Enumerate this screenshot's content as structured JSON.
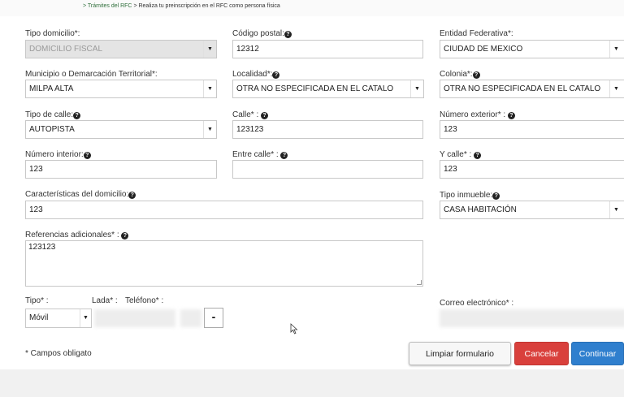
{
  "breadcrumb": {
    "link": "> Trámites del RFC",
    "current": "> Realiza tu preinscripción en el RFC como persona física"
  },
  "help_glyph": "?",
  "fields": {
    "tipo_domicilio": {
      "label": "Tipo domicilio*:",
      "value": "DOMICILIO FISCAL"
    },
    "codigo_postal": {
      "label": "Código postal:",
      "value": "12312"
    },
    "entidad": {
      "label": "Entidad Federativa*:",
      "value": "CIUDAD DE MEXICO"
    },
    "municipio": {
      "label": "Municipio o Demarcación Territorial*:",
      "value": "MILPA ALTA"
    },
    "localidad": {
      "label": "Localidad*:",
      "value": "OTRA NO ESPECIFICADA EN EL CATALO"
    },
    "colonia": {
      "label": "Colonia*:",
      "value": "OTRA NO ESPECIFICADA EN EL CATALO"
    },
    "tipo_calle": {
      "label": "Tipo de calle:",
      "value": "AUTOPISTA"
    },
    "calle": {
      "label": "Calle* :",
      "value": "123123"
    },
    "num_exterior": {
      "label": "Número exterior* :",
      "value": "123"
    },
    "num_interior": {
      "label": "Número interior:",
      "value": "123"
    },
    "entre_calle": {
      "label": "Entre calle* :",
      "value": ""
    },
    "y_calle": {
      "label": "Y calle* :",
      "value": "123"
    },
    "caracteristicas": {
      "label": "Características del domicilio:",
      "value": "123"
    },
    "tipo_inmueble": {
      "label": "Tipo inmueble:",
      "value": "CASA HABITACIÓN"
    },
    "referencias": {
      "label": "Referencias adicionales* :",
      "value": "123123"
    },
    "tipo": {
      "label": "Tipo* :",
      "value": "Móvil"
    },
    "lada": {
      "label": "Lada* :"
    },
    "telefono": {
      "label": "Teléfono* :"
    },
    "correo": {
      "label": "Correo electrónico* :"
    }
  },
  "minus_label": "-",
  "required_note": "* Campos obligato",
  "buttons": {
    "clear": "Limpiar formulario",
    "cancel": "Cancelar",
    "continue": "Continuar"
  },
  "colors": {
    "cancel": "#d9403c",
    "continue": "#2f7fce"
  }
}
